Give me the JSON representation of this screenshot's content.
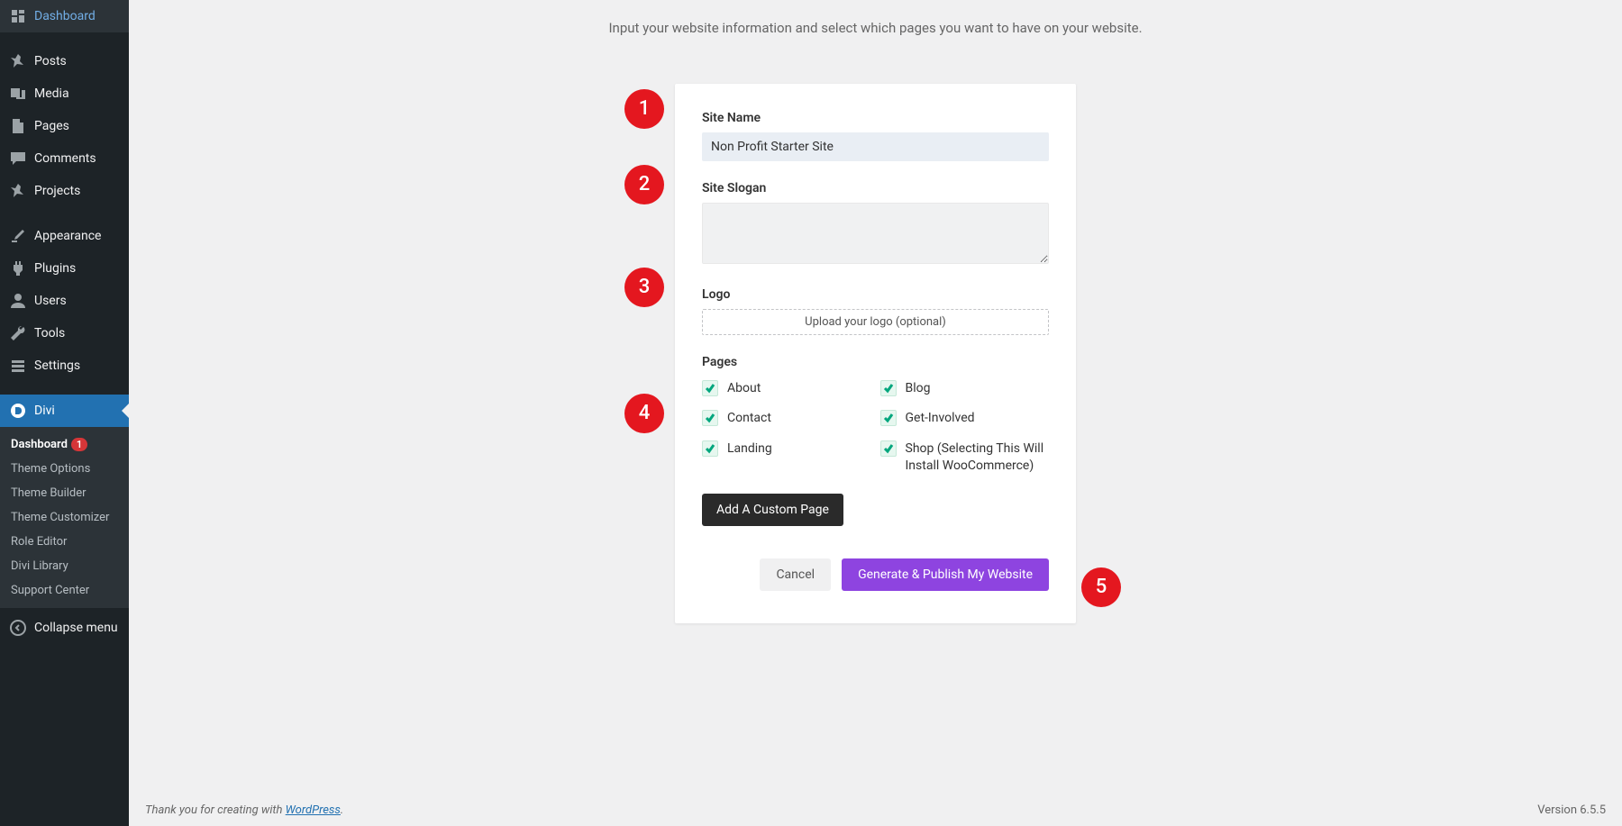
{
  "sidebar": {
    "items": [
      {
        "label": "Dashboard"
      },
      {
        "label": "Posts"
      },
      {
        "label": "Media"
      },
      {
        "label": "Pages"
      },
      {
        "label": "Comments"
      },
      {
        "label": "Projects"
      },
      {
        "label": "Appearance"
      },
      {
        "label": "Plugins"
      },
      {
        "label": "Users"
      },
      {
        "label": "Tools"
      },
      {
        "label": "Settings"
      },
      {
        "label": "Divi"
      }
    ],
    "submenu": [
      {
        "label": "Dashboard",
        "badge": "1"
      },
      {
        "label": "Theme Options"
      },
      {
        "label": "Theme Builder"
      },
      {
        "label": "Theme Customizer"
      },
      {
        "label": "Role Editor"
      },
      {
        "label": "Divi Library"
      },
      {
        "label": "Support Center"
      }
    ],
    "collapse": "Collapse menu"
  },
  "intro": "Input your website information and select which pages you want to have on your website.",
  "form": {
    "site_name_label": "Site Name",
    "site_name_value": "Non Profit Starter Site",
    "site_slogan_label": "Site Slogan",
    "site_slogan_value": "",
    "logo_label": "Logo",
    "logo_upload": "Upload your logo (optional)",
    "pages_label": "Pages",
    "pages": [
      {
        "label": "About"
      },
      {
        "label": "Blog"
      },
      {
        "label": "Contact"
      },
      {
        "label": "Get-Involved"
      },
      {
        "label": "Landing"
      },
      {
        "label": "Shop (Selecting This Will Install WooCommerce)"
      }
    ],
    "add_custom": "Add A Custom Page",
    "cancel": "Cancel",
    "generate": "Generate & Publish My Website"
  },
  "annotations": [
    "1",
    "2",
    "3",
    "4",
    "5"
  ],
  "footer": {
    "thanks_prefix": "Thank you for creating with ",
    "link": "WordPress",
    "suffix": ".",
    "version": "Version 6.5.5"
  }
}
